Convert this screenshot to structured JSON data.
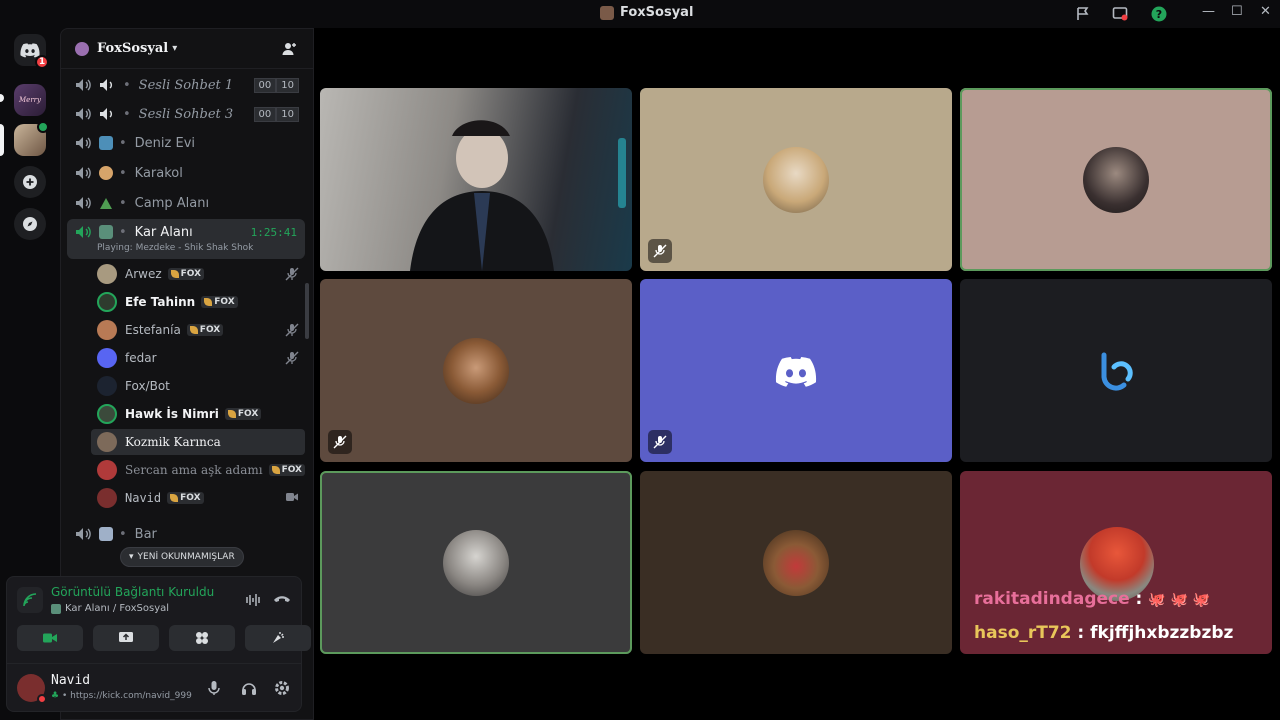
{
  "window": {
    "title": "FoxSosyal"
  },
  "rail": {
    "home_badge": "1",
    "server_label": "Merry"
  },
  "server": {
    "name": "FoxSosyal"
  },
  "channels": [
    {
      "name": "Sesli Sohbet 1",
      "limit_current": "00",
      "limit_max": "10"
    },
    {
      "name": "Sesli Sohbet 3",
      "limit_current": "00",
      "limit_max": "10"
    },
    {
      "name": "Deniz Evi"
    },
    {
      "name": "Karakol"
    },
    {
      "name": "Camp Alanı"
    },
    {
      "name": "Kar Alanı",
      "timer": "1:25:41",
      "activity": "Playing: Mezdeke - Shik Shak Shok"
    },
    {
      "name": "Bar"
    }
  ],
  "members": [
    {
      "name": "Arwez",
      "tag": "FOX"
    },
    {
      "name": "Efe Tahinn",
      "tag": "FOX"
    },
    {
      "name": "Estefanía",
      "tag": "FOX"
    },
    {
      "name": "fedar"
    },
    {
      "name": "Fox/Bot"
    },
    {
      "name": "Hawk İs Nimri",
      "tag": "FOX"
    },
    {
      "name": "Kozmik Karınca"
    },
    {
      "name": "Sercan ama aşk adamı",
      "tag": "FOX"
    },
    {
      "name": "Navid",
      "tag": "FOX"
    }
  ],
  "unread_label": "YENİ OKUNMAMIŞLAR",
  "voice": {
    "status": "Görüntülü Bağlantı Kuruldu",
    "location": "Kar Alanı / FoxSosyal"
  },
  "user": {
    "name": "Navid",
    "status": "https://kick.com/navid_999"
  },
  "chat_overlay": [
    {
      "user": "rakitadindagece",
      "text": " : ",
      "emoji": "🐙 🐙 🐙",
      "color": "#e86f9a"
    },
    {
      "user": "haso_rT72",
      "text": " : fkjffjhxbzzbzbz",
      "emoji": "",
      "color": "#e8c65a"
    }
  ],
  "colors": {
    "accent_green": "#23a55a",
    "blurple": "#5865f2",
    "tile_beige": "#b8a98c",
    "tile_pink": "#b79c92",
    "tile_brown": "#5e4a3e",
    "tile_purple": "#5b5fc7",
    "tile_dark": "#1c1d21",
    "tile_gray": "#3b3b3c",
    "tile_darkbrown": "#3a2e24",
    "tile_maroon": "#6b2634"
  }
}
